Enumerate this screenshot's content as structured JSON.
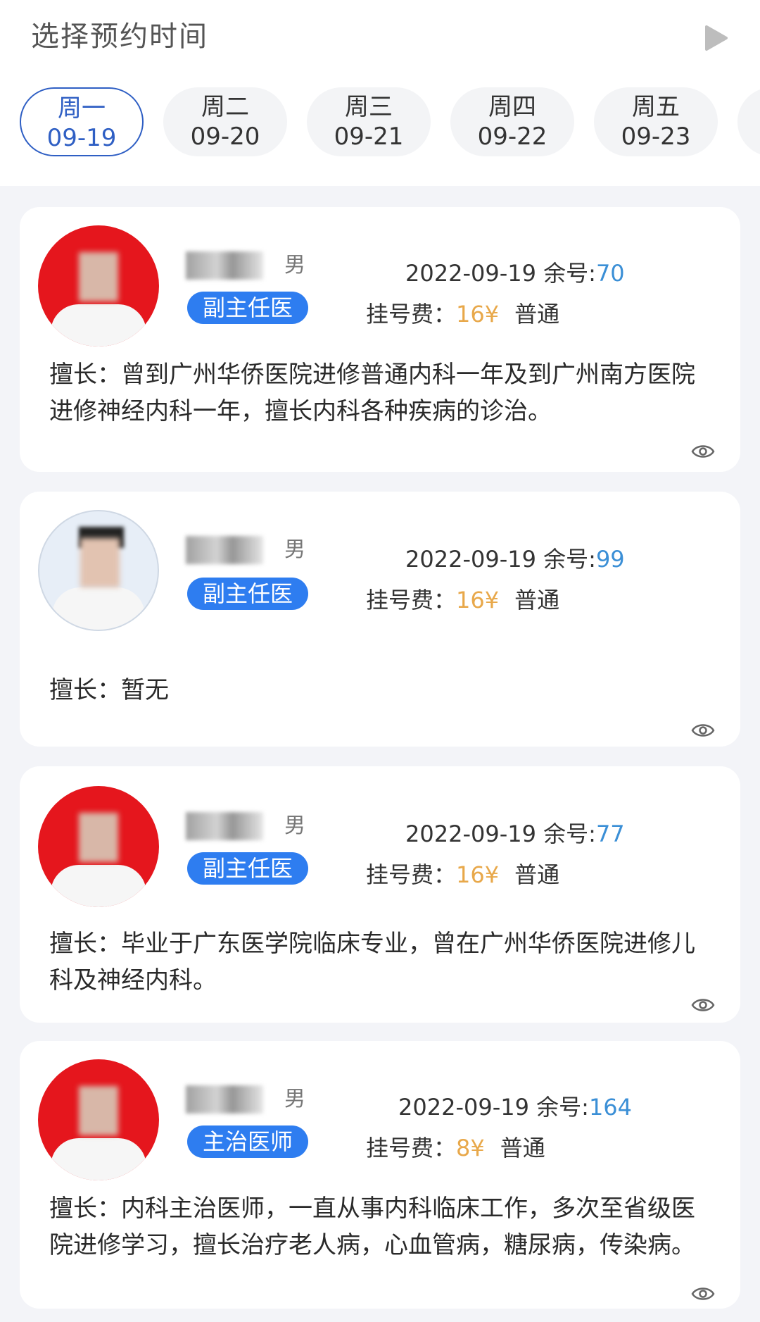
{
  "header": {
    "title": "选择预约时间",
    "play_icon": "play-icon"
  },
  "dates": [
    {
      "weekday": "周一",
      "date": "09-19",
      "active": true
    },
    {
      "weekday": "周二",
      "date": "09-20",
      "active": false
    },
    {
      "weekday": "周三",
      "date": "09-21",
      "active": false
    },
    {
      "weekday": "周四",
      "date": "09-22",
      "active": false
    },
    {
      "weekday": "周五",
      "date": "09-23",
      "active": false
    }
  ],
  "colors": {
    "accent": "#2f5fc4",
    "badge": "#2e7df0",
    "remaining": "#3b8fd6",
    "fee": "#e8a84a"
  },
  "doctors": [
    {
      "gender": "男",
      "title": "副主任医师",
      "date": "2022-09-19",
      "remain_label": "余号:",
      "remain": "70",
      "fee_label": "挂号费：",
      "fee": "16¥",
      "reg_type": "普通",
      "specialty": "擅长：曾到广州华侨医院进修普通内科一年及到广州南方医院进修神经内科一年，擅长内科各种疾病的诊治。"
    },
    {
      "gender": "男",
      "title": "副主任医师",
      "date": "2022-09-19",
      "remain_label": "余号:",
      "remain": "99",
      "fee_label": "挂号费：",
      "fee": "16¥",
      "reg_type": "普通",
      "specialty": "擅长：暂无"
    },
    {
      "gender": "男",
      "title": "副主任医师",
      "date": "2022-09-19",
      "remain_label": "余号:",
      "remain": "77",
      "fee_label": "挂号费：",
      "fee": "16¥",
      "reg_type": "普通",
      "specialty": "擅长：毕业于广东医学院临床专业，曾在广州华侨医院进修儿科及神经内科。"
    },
    {
      "gender": "男",
      "title": "主治医师",
      "date": "2022-09-19",
      "remain_label": "余号:",
      "remain": "164",
      "fee_label": "挂号费：",
      "fee": "8¥",
      "reg_type": "普通",
      "specialty": "擅长：内科主治医师，一直从事内科临床工作，多次至省级医院进修学习，擅长治疗老人病，心血管病，糖尿病，传染病。"
    }
  ]
}
